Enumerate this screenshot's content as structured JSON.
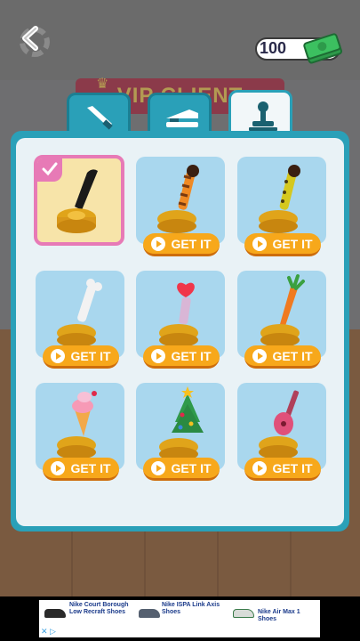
{
  "background": {
    "banner_text": "VIP CLIENT"
  },
  "header": {
    "back_icon": "back-arrow-icon",
    "cash_value": "100",
    "cash_icon": "money-stack-icon"
  },
  "tabs": [
    {
      "name": "knife",
      "icon": "knife-icon",
      "active": false
    },
    {
      "name": "stapler",
      "icon": "stapler-icon",
      "active": false
    },
    {
      "name": "stamp",
      "icon": "stamp-icon",
      "active": true
    }
  ],
  "items": [
    {
      "name": "classic-stamp",
      "selected": true,
      "owned": true
    },
    {
      "name": "cat-paw-orange",
      "button": "GET IT"
    },
    {
      "name": "cat-paw-leopard",
      "button": "GET IT"
    },
    {
      "name": "bone",
      "button": "GET IT"
    },
    {
      "name": "heart",
      "button": "GET IT"
    },
    {
      "name": "carrot",
      "button": "GET IT"
    },
    {
      "name": "ice-cream",
      "button": "GET IT"
    },
    {
      "name": "christmas-tree",
      "button": "GET IT"
    },
    {
      "name": "guitar",
      "button": "GET IT"
    }
  ],
  "ad": {
    "products": [
      {
        "title": "Nike Court Borough Low Recraft Shoes"
      },
      {
        "title": "Nike ISPA Link Axis Shoes"
      },
      {
        "title": "Nike Air Max 1 Shoes"
      }
    ],
    "colors": {
      "link": "#1a3a8a"
    }
  },
  "colors": {
    "panel": "#2aa0b8",
    "card": "#a9d7ee",
    "selected_border": "#e77ab6",
    "button": "#f7a81b"
  }
}
